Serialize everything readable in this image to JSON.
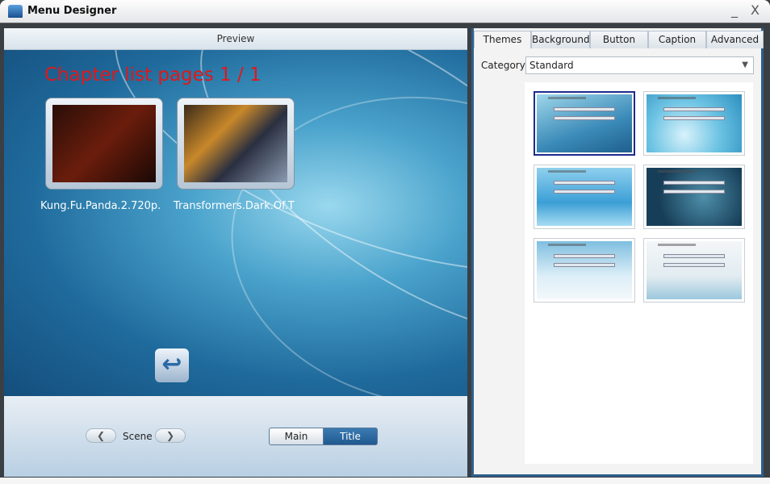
{
  "window": {
    "title": "Menu Designer",
    "minimize": "_",
    "close": "X"
  },
  "preview": {
    "header": "Preview",
    "chapter_title": "Chapter list pages 1 / 1",
    "items": [
      {
        "label": "Kung.Fu.Panda.2.720p."
      },
      {
        "label": "Transformers.Dark.Of.T"
      }
    ],
    "back_icon": "↩"
  },
  "controls": {
    "prev": "❮",
    "scene": "Scene",
    "next": "❯",
    "main": "Main",
    "title": "Title",
    "active": "Title"
  },
  "panel": {
    "tabs": [
      "Themes",
      "Background",
      "Button",
      "Caption",
      "Advanced"
    ],
    "active_tab": "Themes",
    "category_label": "Category",
    "category_value": "Standard",
    "themes": [
      {
        "selected": true
      },
      {
        "selected": false
      },
      {
        "selected": false
      },
      {
        "selected": false
      },
      {
        "selected": false
      },
      {
        "selected": false
      }
    ]
  },
  "colors": {
    "accent": "#2d5f8c",
    "chapter": "#e01818"
  }
}
